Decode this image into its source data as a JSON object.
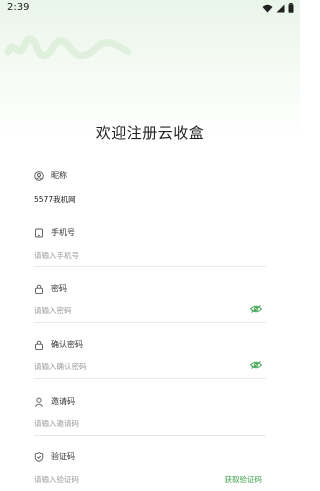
{
  "status_bar": {
    "time": "2:39"
  },
  "page": {
    "title": "欢迎注册云收盒"
  },
  "form": {
    "nickname": {
      "label": "昵称",
      "value": "5577我机网"
    },
    "phone": {
      "label": "手机号",
      "placeholder": "请输入手机号"
    },
    "password": {
      "label": "密码",
      "placeholder": "请输入密码"
    },
    "confirm_password": {
      "label": "确认密码",
      "placeholder": "请输入确认密码"
    },
    "invite_code": {
      "label": "邀请码",
      "placeholder": "请输入邀请码"
    },
    "verify_code": {
      "label": "验证码",
      "placeholder": "请输入验证码",
      "get_code_label": "获取验证码"
    }
  },
  "colors": {
    "accent": "#3aa64a",
    "icon_gray": "#555555"
  },
  "icons": [
    "wifi-icon",
    "signal-icon",
    "battery-icon",
    "user-circle-icon",
    "phone-icon",
    "lock-icon",
    "lock-icon",
    "person-icon",
    "shield-icon",
    "eye-icon"
  ]
}
